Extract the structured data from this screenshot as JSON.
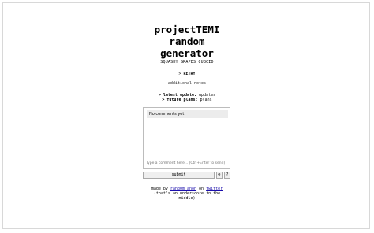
{
  "title_lines": [
    "projectTEMI",
    "random",
    "generator"
  ],
  "subtitle": "SQUASHY GRAPES CUBOID",
  "retry": {
    "prefix": ">",
    "label": "RETRY"
  },
  "notes": "additional notes",
  "info": {
    "latest_update_label": "> latest update:",
    "latest_update_value": "updates",
    "future_plans_label": "> future plans:",
    "future_plans_value": "plans"
  },
  "comments": {
    "empty_text": "No comments yet!",
    "placeholder": "Type a comment here... (Ctrl+Enter to send)",
    "submit_label": "submit",
    "settings_glyph": "⚙",
    "help_glyph": "?"
  },
  "footer": {
    "made_by": "made by",
    "author": "rand0m anon",
    "on": "on",
    "platform": "twitter",
    "note": "(that's an underscore in the middle)"
  }
}
